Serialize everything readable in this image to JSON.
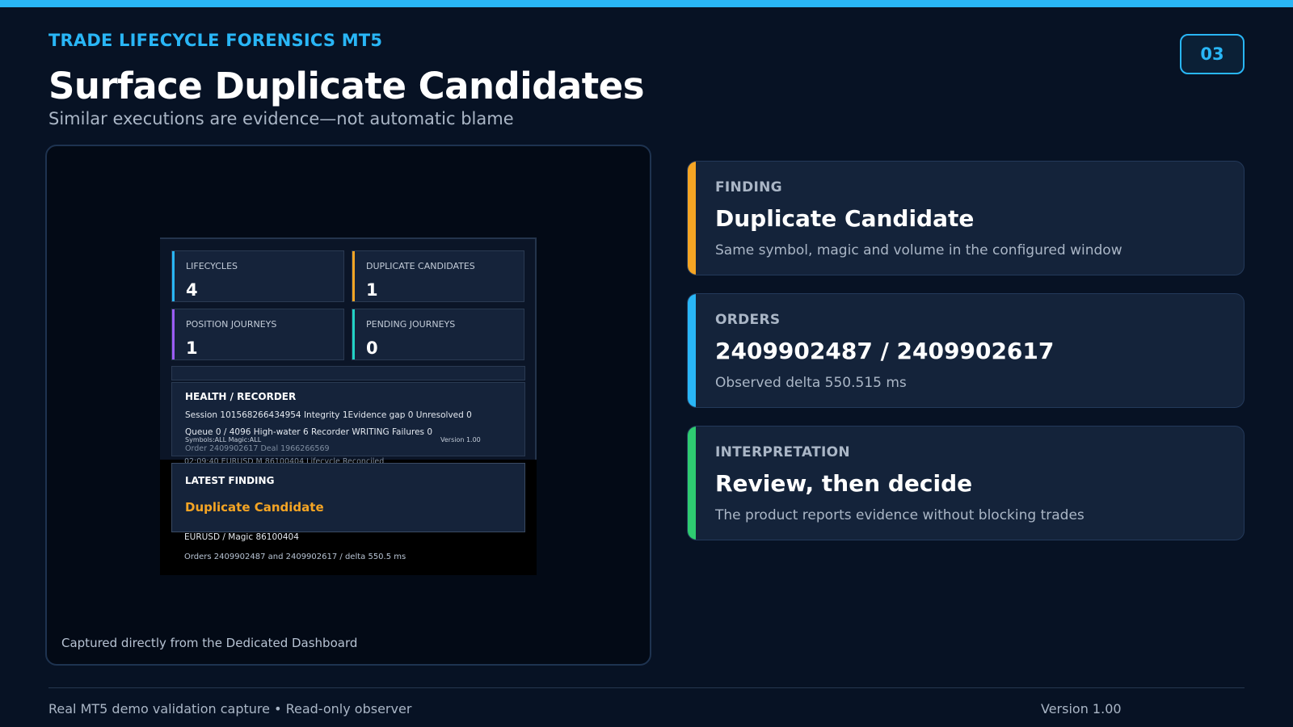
{
  "header": {
    "kicker": "TRADE LIFECYCLE FORENSICS MT5",
    "page_number": "03",
    "title": "Surface Duplicate Candidates",
    "subtitle": "Similar executions are evidence—not automatic blame"
  },
  "screenshot": {
    "caption": "Captured directly from the Dedicated Dashboard",
    "metrics": [
      {
        "label": "LIFECYCLES",
        "value": "4",
        "color": "#29b6f6"
      },
      {
        "label": "DUPLICATE CANDIDATES",
        "value": "1",
        "color": "#f5a524"
      },
      {
        "label": "POSITION JOURNEYS",
        "value": "1",
        "color": "#9b5cf6"
      },
      {
        "label": "PENDING JOURNEYS",
        "value": "0",
        "color": "#22d3c5"
      }
    ],
    "health": {
      "title": "HEALTH / RECORDER",
      "row1": "Session  101568266434954    Integrity  1Evidence gap  0    Unresolved  0",
      "row2": "Queue  0 / 4096    High-water  6            Recorder  WRITING    Failures  0",
      "small_left": "Symbols:ALL Magic:ALL",
      "small_right": "Version 1.00",
      "ghost1": "Order 2409902617  Deal 1966266569",
      "ghost2": "02:09:40  EURUSD  M 86100404  Lifecycle Reconciled"
    },
    "latest": {
      "title": "LATEST FINDING",
      "name": "Duplicate Candidate",
      "line1": "EURUSD / Magic 86100404",
      "line2": "Orders 2409902487 and 2409902617 / delta 550.5 ms"
    }
  },
  "cards": [
    {
      "label": "FINDING",
      "value": "Duplicate Candidate",
      "desc": "Same symbol, magic and volume in the configured window",
      "color": "#f5a524"
    },
    {
      "label": "ORDERS",
      "value": "2409902487 / 2409902617",
      "desc": "Observed delta 550.515 ms",
      "color": "#29b6f6"
    },
    {
      "label": "INTERPRETATION",
      "value": "Review, then decide",
      "desc": "The product reports evidence without blocking trades",
      "color": "#2ecc71"
    }
  ],
  "footer": {
    "left": "Real MT5 demo validation capture • Read-only observer",
    "right": "Version 1.00"
  }
}
